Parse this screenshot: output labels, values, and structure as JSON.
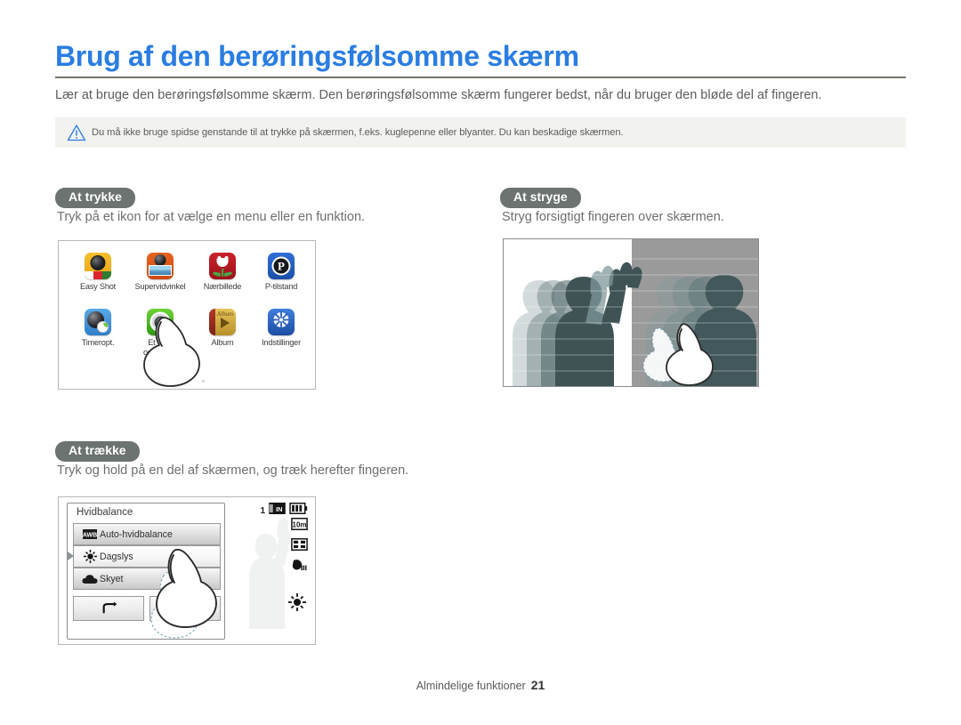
{
  "header": {
    "title": "Brug af den berøringsfølsomme skærm",
    "intro": "Lær at bruge den berøringsfølsomme skærm. Den berøringsfølsomme skærm fungerer bedst, når du bruger den bløde del af fingeren.",
    "title_color": "#2a7de1",
    "rule_color": "#74776b"
  },
  "caution": {
    "icon": "warning-triangle-icon",
    "text": "Du må ikke bruge spidse genstande til at trykke på skærmen, f.eks. kuglepenne eller blyanter. Du kan beskadige skærmen.",
    "bg_color": "#f2f2ee",
    "icon_color": "#2a7de1"
  },
  "sections": {
    "tap": {
      "pill": "At trykke",
      "desc": "Tryk på et ikon for at vælge en menu eller en funktion.",
      "icons": [
        {
          "label": "Easy Shot",
          "art": "easyshot"
        },
        {
          "label": "Supervidvinkel",
          "art": "wide"
        },
        {
          "label": "Nærbillede",
          "art": "macro"
        },
        {
          "label": "P-tilstand",
          "art": "pmode",
          "glyph": "P"
        },
        {
          "label": "Timeropt.",
          "art": "timer"
        },
        {
          "label": "Et tryk-\noptagelse",
          "art": "onetouch"
        },
        {
          "label": "Album",
          "art": "album",
          "glyph": "Album"
        },
        {
          "label": "Indstillinger",
          "art": "settings"
        }
      ],
      "page_dots": 3,
      "active_dot": 0
    },
    "swipe": {
      "pill": "At stryge",
      "desc": "Stryg forsigtigt fingeren over skærmen."
    },
    "drag": {
      "pill": "At trække",
      "desc": "Tryk og hold på en del af skærmen, og træk herefter fingeren.",
      "camera": {
        "menu_title": "Hvidbalance",
        "options": [
          {
            "label": "Auto-hvidbalance",
            "icon": "awb-icon",
            "selected": false
          },
          {
            "label": "Dagslys",
            "icon": "sun-icon",
            "selected": true
          },
          {
            "label": "Skyet",
            "icon": "cloud-icon",
            "selected": false
          }
        ],
        "buttons": [
          {
            "name": "back-button",
            "glyph": "↰"
          },
          {
            "name": "ok-button",
            "glyph": "↙"
          }
        ],
        "status": {
          "count": "1",
          "memory_chip": "IN",
          "battery": "battery-full-icon",
          "resolution": "resolution-icon",
          "quality": "quality-icon",
          "burst": "burst-icon",
          "wb_indicator": "sun-icon"
        }
      }
    }
  },
  "pill_color": "#6c7370",
  "footer": {
    "label": "Almindelige funktioner",
    "page": "21"
  }
}
